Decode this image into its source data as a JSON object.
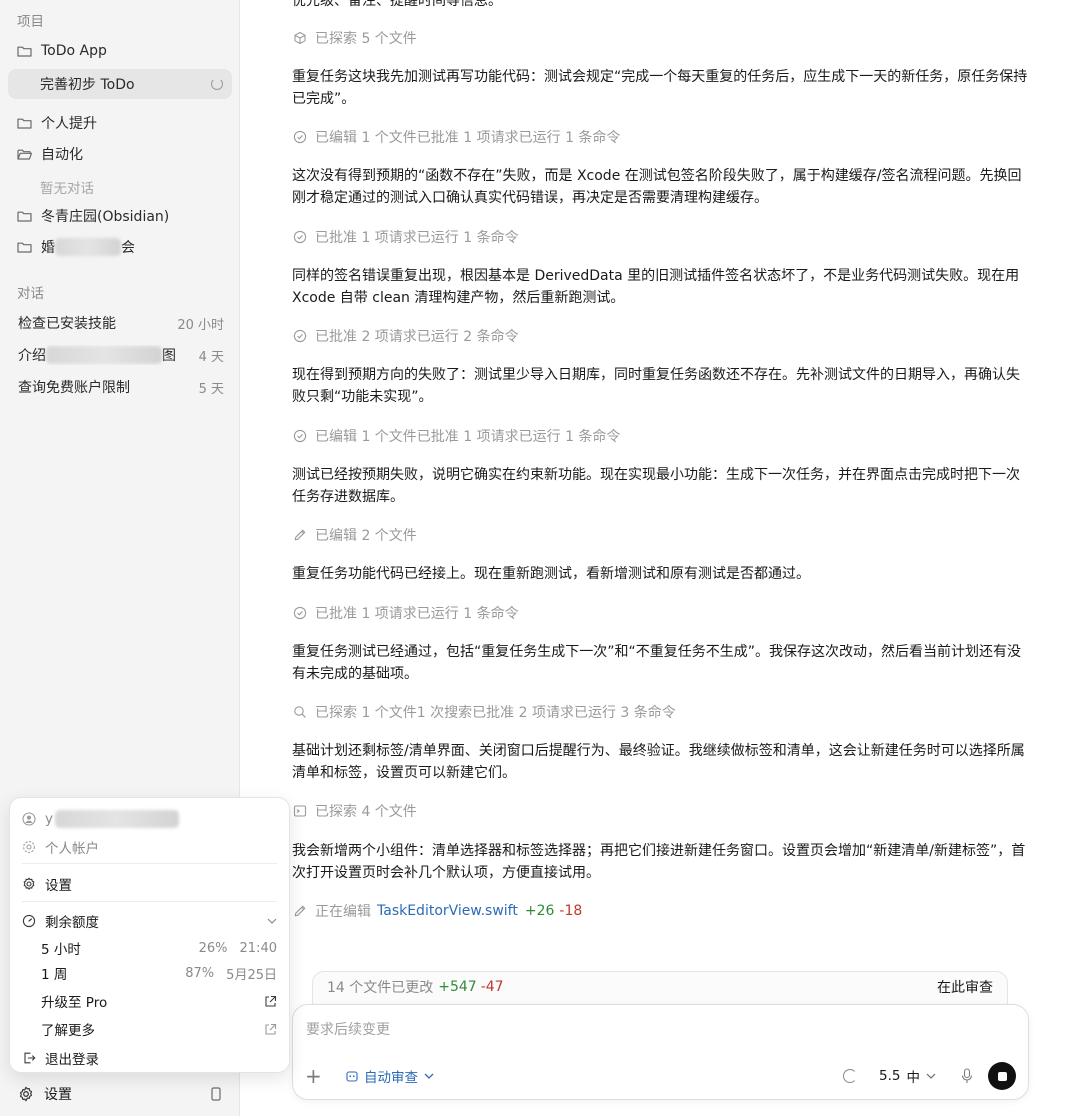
{
  "sidebar": {
    "projects_title": "项目",
    "projects": [
      {
        "label": "ToDo App"
      },
      {
        "label": "完善初步 ToDo",
        "active": true
      },
      {
        "label": "个人提升"
      },
      {
        "label": "自动化"
      },
      {
        "label": "暂无对话",
        "empty_note": true
      },
      {
        "label": "冬青庄园(Obsidian)"
      },
      {
        "label_visible_start": "婚",
        "label_visible_end": "会",
        "partially_obscured": true
      }
    ],
    "conversations_title": "对话",
    "conversations": [
      {
        "label": "检查已安装技能",
        "time": "20 小时"
      },
      {
        "label_visible_start": "介绍",
        "label_visible_end": "图",
        "time": "4 天",
        "partially_obscured": true
      },
      {
        "label": "查询免费账户限制",
        "time": "5 天"
      }
    ],
    "bottom": {
      "settings_label": "设置"
    }
  },
  "popover": {
    "account_initial": "y",
    "account_type": "个人帐户",
    "settings": "设置",
    "quota_title": "剩余额度",
    "quota": [
      {
        "label": "5 小时",
        "percent": "26%",
        "reset": "21:40"
      },
      {
        "label": "1 周",
        "percent": "87%",
        "reset": "5月25日"
      }
    ],
    "upgrade": "升级至 Pro",
    "learn_more": "了解更多",
    "logout": "退出登录"
  },
  "main": {
    "cut_text": "优先级、备注、提醒时间等信息。",
    "feed": [
      {
        "type": "step",
        "icon": "cube-icon",
        "text": "已探索 5 个文件"
      },
      {
        "type": "para",
        "text": "重复任务这块我先加测试再写功能代码：测试会规定“完成一个每天重复的任务后，应生成下一天的新任务，原任务保持已完成”。"
      },
      {
        "type": "step",
        "icon": "check-circle-icon",
        "text": "已编辑 1 个文件已批准 1 项请求已运行 1 条命令"
      },
      {
        "type": "para",
        "text": "这次没有得到预期的“函数不存在”失败，而是 Xcode 在测试包签名阶段失败了，属于构建缓存/签名流程问题。先换回刚才稳定通过的测试入口确认真实代码错误，再决定是否需要清理构建缓存。"
      },
      {
        "type": "step",
        "icon": "check-circle-icon",
        "text": "已批准 1 项请求已运行 1 条命令"
      },
      {
        "type": "para",
        "text": "同样的签名错误重复出现，根因基本是 DerivedData 里的旧测试插件签名状态坏了，不是业务代码测试失败。现在用 Xcode 自带 clean 清理构建产物，然后重新跑测试。"
      },
      {
        "type": "step",
        "icon": "check-circle-icon",
        "text": "已批准 2 项请求已运行 2 条命令"
      },
      {
        "type": "para",
        "text": "现在得到预期方向的失败了：测试里少导入日期库，同时重复任务函数还不存在。先补测试文件的日期导入，再确认失败只剩“功能未实现”。"
      },
      {
        "type": "step",
        "icon": "check-circle-icon",
        "text": "已编辑 1 个文件已批准 1 项请求已运行 1 条命令"
      },
      {
        "type": "para",
        "text": "测试已经按预期失败，说明它确实在约束新功能。现在实现最小功能：生成下一次任务，并在界面点击完成时把下一次任务存进数据库。"
      },
      {
        "type": "step",
        "icon": "pencil-icon",
        "text": "已编辑 2 个文件"
      },
      {
        "type": "para",
        "text": "重复任务功能代码已经接上。现在重新跑测试，看新增测试和原有测试是否都通过。"
      },
      {
        "type": "step",
        "icon": "check-circle-icon",
        "text": "已批准 1 项请求已运行 1 条命令"
      },
      {
        "type": "para",
        "text": "重复任务测试已经通过，包括“重复任务生成下一次”和“不重复任务不生成”。我保存这次改动，然后看当前计划还有没有未完成的基础项。"
      },
      {
        "type": "step",
        "icon": "search-icon",
        "text": "已探索 1 个文件1 次搜索已批准 2 项请求已运行 3 条命令"
      },
      {
        "type": "para",
        "text": "基础计划还剩标签/清单界面、关闭窗口后提醒行为、最终验证。我继续做标签和清单，这会让新建任务时可以选择所属清单和标签，设置页可以新建它们。"
      },
      {
        "type": "step",
        "icon": "terminal-icon",
        "text": "已探索 4 个文件"
      },
      {
        "type": "para",
        "text": "我会新增两个小组件：清单选择器和标签选择器；再把它们接进新建任务窗口。设置页会增加“新建清单/新建标签”，首次打开设置页时会补几个默认项，方便直接试用。"
      }
    ],
    "editing": {
      "prefix": "正在编辑",
      "file": "TaskEditorView.swift",
      "added": "+26",
      "removed": "-18"
    },
    "changes": {
      "summary": "14 个文件已更改",
      "added": "+547",
      "removed": "-47",
      "review": "在此审查"
    },
    "composer": {
      "placeholder": "要求后续变更",
      "auto_review": "自动审查",
      "model": "5.5",
      "effort": "中"
    }
  },
  "colors": {
    "accent": "#2b6bb8",
    "added": "#2e8b3a",
    "removed": "#c0392b",
    "sidebar_bg": "#f4f4f4"
  }
}
